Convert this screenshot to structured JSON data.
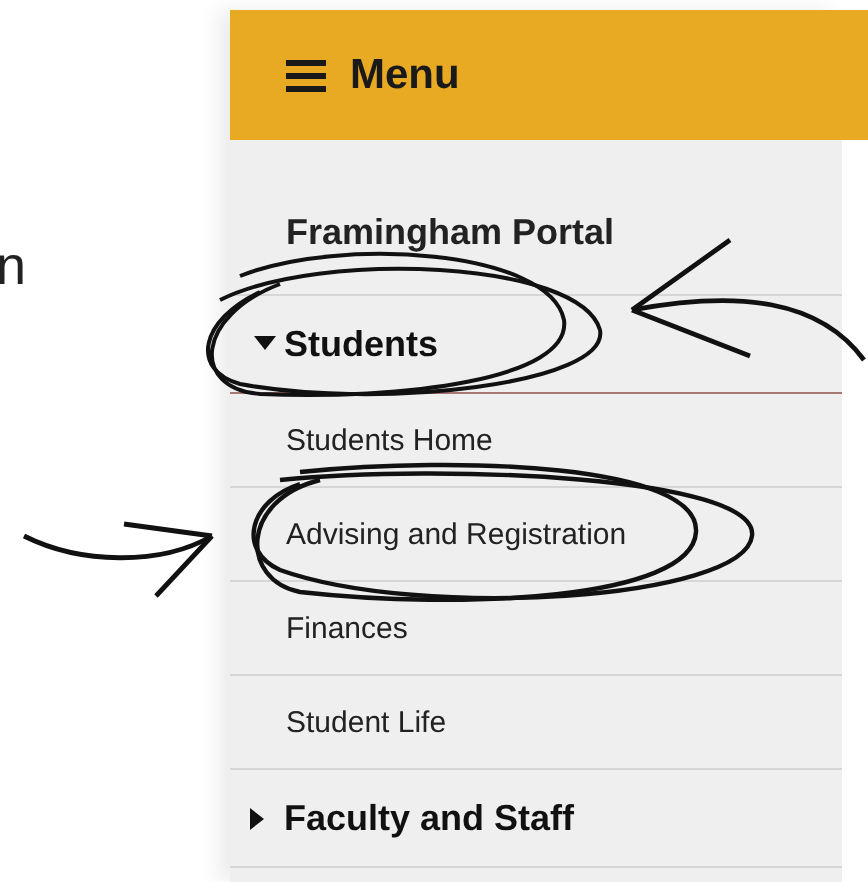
{
  "side_text": "n",
  "menu": {
    "title": "Menu",
    "portal": "Framingham Portal",
    "groups": [
      {
        "label": "Students",
        "expanded": true,
        "children": [
          {
            "label": "Students Home"
          },
          {
            "label": "Advising and Registration"
          },
          {
            "label": "Finances"
          },
          {
            "label": "Student Life"
          }
        ]
      },
      {
        "label": "Faculty and Staff",
        "expanded": false
      }
    ]
  }
}
